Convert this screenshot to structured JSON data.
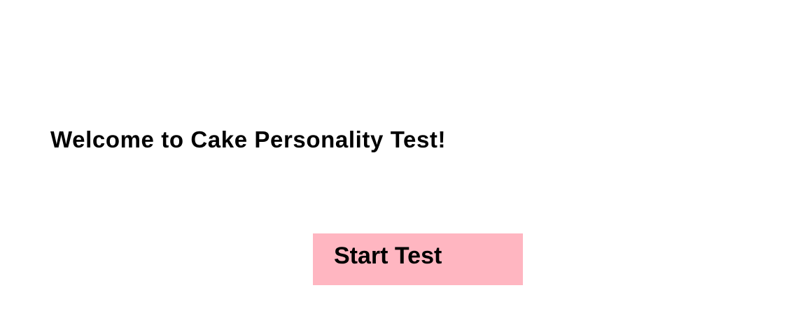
{
  "welcome": {
    "title": "Welcome to Cake Personality Test!"
  },
  "actions": {
    "start_label": "Start Test"
  },
  "colors": {
    "background": "#ffffff",
    "button_background": "#ffb6c1",
    "text": "#000000"
  }
}
